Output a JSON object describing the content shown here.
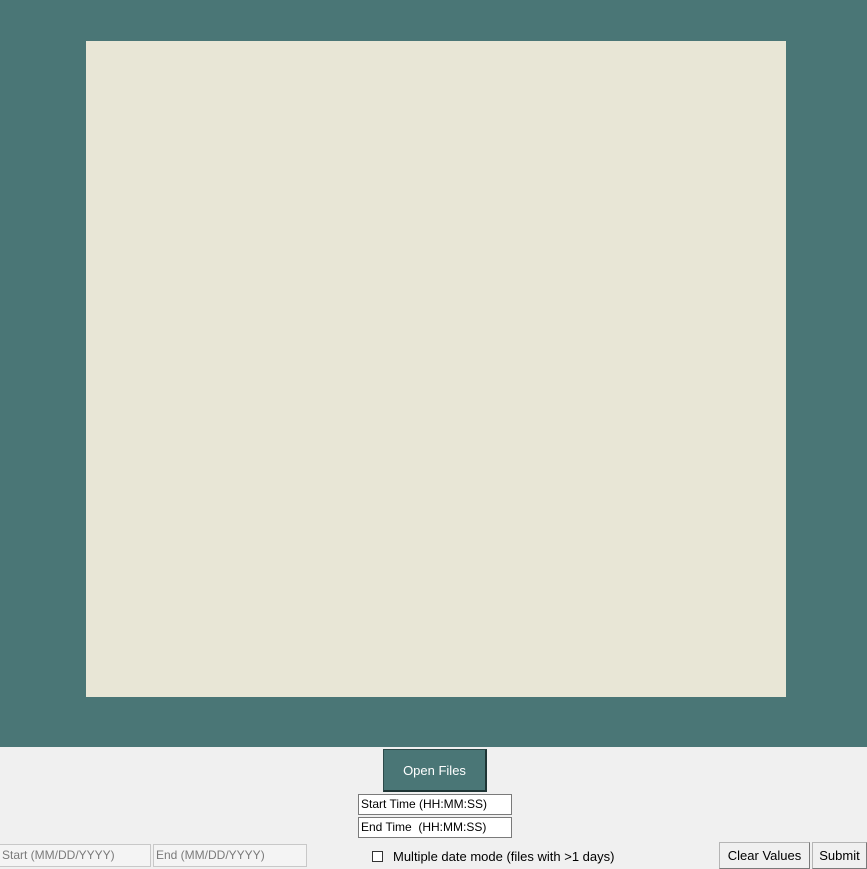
{
  "open_files": {
    "label": "Open Files"
  },
  "time": {
    "start_label": "Start Time (HH:MM:SS)",
    "end_label": "End Time  (HH:MM:SS)"
  },
  "dates": {
    "start_placeholder": "Start (MM/DD/YYYY)",
    "end_placeholder": "End (MM/DD/YYYY)"
  },
  "multi_date": {
    "label": "Multiple date mode (files with >1 days)",
    "checked": false
  },
  "actions": {
    "clear_label": "Clear Values",
    "submit_label": "Submit"
  },
  "colors": {
    "frame": "#4a7676",
    "canvas": "#e8e6d6",
    "panel": "#f0f0f0"
  }
}
